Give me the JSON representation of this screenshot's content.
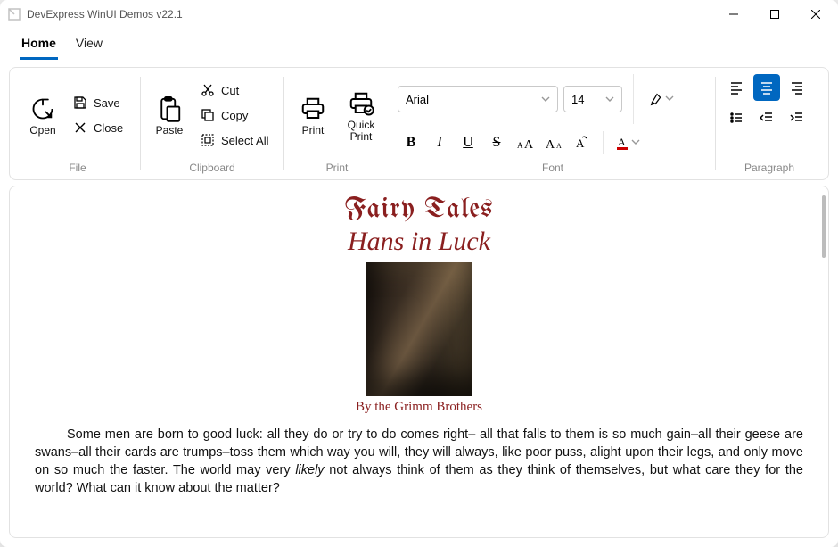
{
  "window": {
    "title": "DevExpress WinUI Demos v22.1"
  },
  "tabs": {
    "home": "Home",
    "view": "View"
  },
  "ribbon": {
    "file": {
      "label": "File",
      "open": "Open",
      "save": "Save",
      "close": "Close"
    },
    "clipboard": {
      "label": "Clipboard",
      "paste": "Paste",
      "cut": "Cut",
      "copy": "Copy",
      "selectall": "Select All"
    },
    "print": {
      "label": "Print",
      "print": "Print",
      "quick": "Quick\nPrint"
    },
    "font": {
      "label": "Font",
      "family": "Arial",
      "size": "14"
    },
    "paragraph": {
      "label": "Paragraph"
    }
  },
  "document": {
    "title": "Fairy Tales",
    "subtitle": "Hans in Luck",
    "author": "By the Grimm Brothers",
    "body1": "Some men are born to good luck: all they do or try to do comes right– all that falls to them is so much gain–all their geese are swans–all their cards are trumps–toss them which way you will, they will always, like poor puss, alight upon their legs, and only move on so much the faster. The world may very ",
    "body_italic": "likely",
    "body2": " not always think of them as they think of themselves, but what care they for the world? What can it know about the matter?"
  }
}
